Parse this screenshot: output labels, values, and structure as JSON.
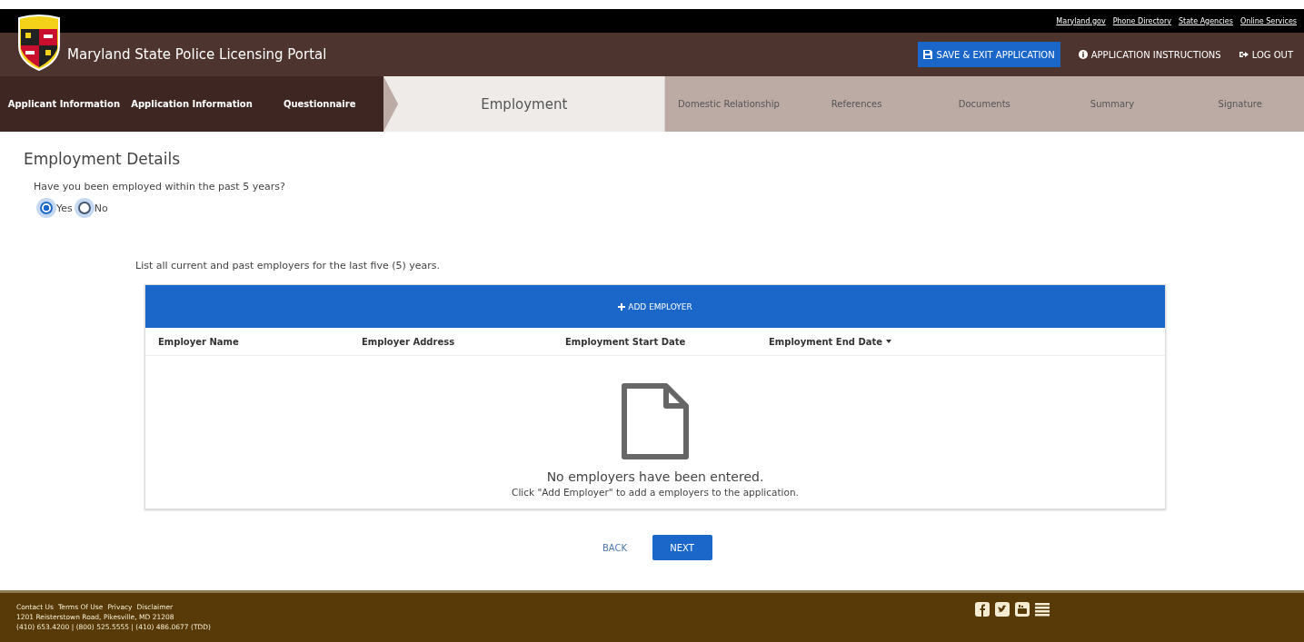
{
  "utility_links": [
    "Maryland.gov",
    "Phone Directory",
    "State Agencies",
    "Online Services"
  ],
  "header": {
    "title": "Maryland State Police Licensing Portal",
    "save_button": "SAVE & EXIT APPLICATION",
    "instructions_link": "APPLICATION INSTRUCTIONS",
    "logout_link": "LOG OUT"
  },
  "steps": [
    {
      "label": "Applicant Information",
      "completed": true,
      "selected": false
    },
    {
      "label": "Application Information",
      "completed": true,
      "selected": false
    },
    {
      "label": "Questionnaire",
      "completed": true,
      "selected": false
    },
    {
      "label": "Employment",
      "completed": false,
      "selected": true
    },
    {
      "label": "Domestic Relationship",
      "completed": false,
      "selected": false
    },
    {
      "label": "References",
      "completed": false,
      "selected": false
    },
    {
      "label": "Documents",
      "completed": false,
      "selected": false
    },
    {
      "label": "Summary",
      "completed": false,
      "selected": false
    },
    {
      "label": "Signature",
      "completed": false,
      "selected": false
    }
  ],
  "section_title": "Employment Details",
  "question": "Have you been employed within the past 5 years?",
  "options": [
    {
      "label": "Yes",
      "selected": true
    },
    {
      "label": "No",
      "selected": false
    }
  ],
  "instruction": "List all current and past employers for the last five (5) years.",
  "add_button": "ADD EMPLOYER",
  "table": {
    "columns": [
      {
        "label": "Employer Name",
        "sorted": false
      },
      {
        "label": "Employer Address",
        "sorted": false
      },
      {
        "label": "Employment Start Date",
        "sorted": false
      },
      {
        "label": "Employment End Date",
        "sorted": true
      }
    ],
    "empty_title": "No employers have been entered.",
    "empty_hint": "Click \"Add Employer\" to add a employers to the application."
  },
  "back_button": "BACK",
  "next_button": "NEXT",
  "footer": {
    "links": [
      "Contact Us",
      "Terms Of Use",
      "Privacy",
      "Disclaimer"
    ],
    "address": "1201 Reisterstown Road, Pikesville, MD 21208",
    "phones": "(410) 653.4200 | (800) 525.5555 | (410) 486.0677 (TDD)"
  }
}
